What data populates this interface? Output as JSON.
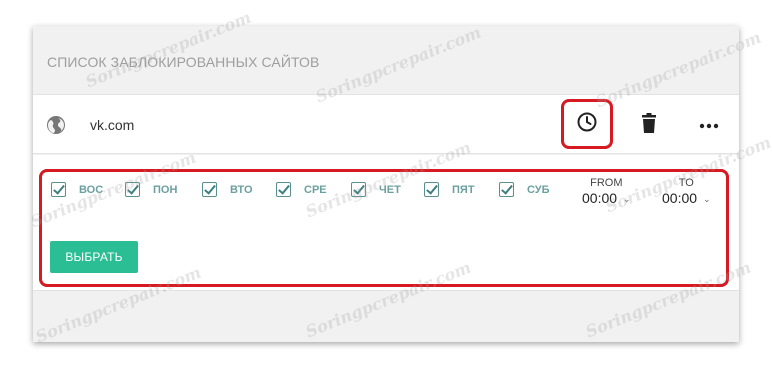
{
  "section_title": "СПИСОК ЗАБЛОКИРОВАННЫХ САЙТОВ",
  "site": {
    "name": "vk.com",
    "icon": "globe-icon"
  },
  "actions": {
    "schedule_icon": "clock-icon",
    "delete_icon": "trash-icon",
    "more_icon": "more-dots-icon"
  },
  "schedule": {
    "days": [
      {
        "label": "ВОС",
        "checked": true
      },
      {
        "label": "ПОН",
        "checked": true
      },
      {
        "label": "ВТО",
        "checked": true
      },
      {
        "label": "СРЕ",
        "checked": true
      },
      {
        "label": "ЧЕТ",
        "checked": true
      },
      {
        "label": "ПЯТ",
        "checked": true
      },
      {
        "label": "СУБ",
        "checked": true
      }
    ],
    "from": {
      "label": "FROM",
      "value": "00:00"
    },
    "to": {
      "label": "TO",
      "value": "00:00"
    },
    "submit_label": "ВЫБРАТЬ"
  },
  "watermark_text": "Soringpcrepair.com",
  "colors": {
    "highlight": "#d71921",
    "accent": "#2bbd93",
    "day_label": "#6ca0a0"
  }
}
